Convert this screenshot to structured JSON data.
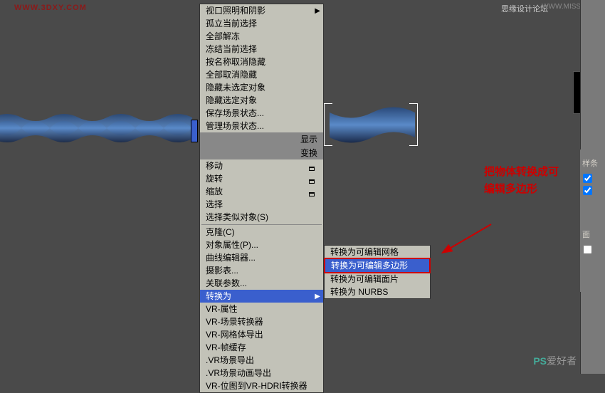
{
  "watermarks": {
    "left": "WWW.3DXY.COM",
    "right": "思缘设计论坛",
    "url": "WWW.MISSYUAN.COM"
  },
  "menu_headers": {
    "display": "显示",
    "transform": "变换"
  },
  "menu_items": [
    "视口照明和阴影",
    "孤立当前选择",
    "全部解冻",
    "冻结当前选择",
    "按名称取消隐藏",
    "全部取消隐藏",
    "隐藏未选定对象",
    "隐藏选定对象",
    "保存场景状态...",
    "管理场景状态..."
  ],
  "transform_items": [
    "移动",
    "旋转",
    "缩放",
    "选择",
    "选择类似对象(S)"
  ],
  "tool_items": [
    "克隆(C)",
    "对象属性(P)...",
    "曲线编辑器...",
    "摄影表...",
    "关联参数..."
  ],
  "convert_label": "转换为",
  "vr_items": [
    "VR-属性",
    "VR-场景转换器",
    "VR-网格体导出",
    "VR-帧缓存",
    ".VR场景导出",
    ".VR场景动画导出",
    "VR-位图到VR-HDRI转换器"
  ],
  "submenu_items": [
    "转换为可编辑网格",
    "转换为可编辑多边形",
    "转换为可编辑面片",
    "转换为 NURBS"
  ],
  "annotation": {
    "line1": "把物体转换成可",
    "line2": "编辑多边形"
  },
  "panel": {
    "section_label": "样条",
    "face_label": "面"
  },
  "logo": "PS爱好者"
}
